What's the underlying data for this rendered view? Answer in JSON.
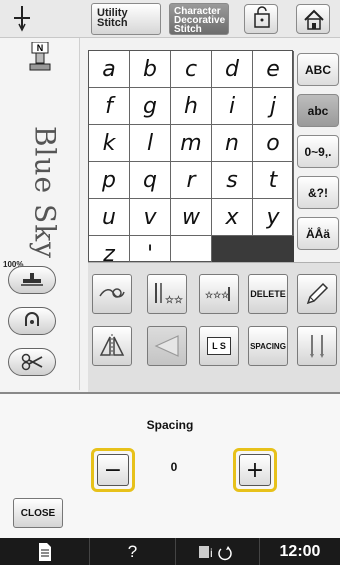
{
  "top": {
    "utility_tab": "Utility Stitch",
    "character_tab": "Character Decorative Stitch"
  },
  "preview_text": "Blue Sky",
  "zoom": "100%",
  "foot_label": "N",
  "grid_chars": [
    "a",
    "b",
    "c",
    "d",
    "e",
    "f",
    "g",
    "h",
    "i",
    "j",
    "k",
    "l",
    "m",
    "n",
    "o",
    "p",
    "q",
    "r",
    "s",
    "t",
    "u",
    "v",
    "w",
    "x",
    "y",
    "z",
    "'",
    "_"
  ],
  "type_buttons": [
    "ABC",
    "abc",
    "0~9,.",
    "&?!",
    "ÄÅä"
  ],
  "tools": {
    "delete": "DELETE",
    "ls": "L S",
    "spacing": "SPACING"
  },
  "dialog": {
    "title": "Spacing",
    "value": "0",
    "close": "CLOSE"
  },
  "status": {
    "help": "?",
    "time": "12:00"
  },
  "colors": {
    "highlight": "#e7c11a",
    "statusbar": "#1a1a1a"
  }
}
